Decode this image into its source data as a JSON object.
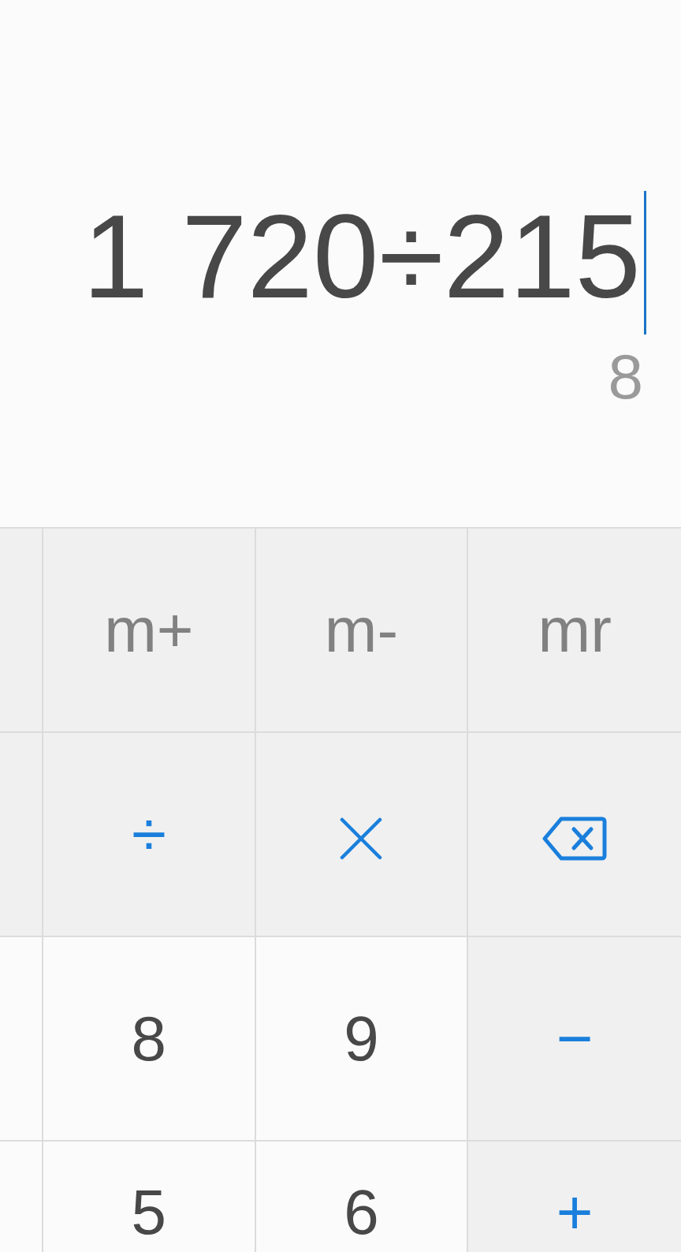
{
  "display": {
    "expression": "1 720÷215",
    "cursor_visible": true,
    "result": "8"
  },
  "keypad": [
    {
      "keys": [
        {
          "kind": "memory",
          "label": "m+"
        },
        {
          "kind": "memory",
          "label": "m-"
        },
        {
          "kind": "memory",
          "label": "mr"
        }
      ]
    },
    {
      "keys": [
        {
          "kind": "operator",
          "label": "÷"
        },
        {
          "kind": "multiply"
        },
        {
          "kind": "backspace"
        }
      ]
    },
    {
      "keys": [
        {
          "kind": "digit",
          "label": "8"
        },
        {
          "kind": "digit",
          "label": "9"
        },
        {
          "kind": "operator",
          "label": "−"
        }
      ]
    },
    {
      "keys": [
        {
          "kind": "digit",
          "label": "5"
        },
        {
          "kind": "digit",
          "label": "6"
        },
        {
          "kind": "operator",
          "label": "+"
        }
      ]
    }
  ]
}
